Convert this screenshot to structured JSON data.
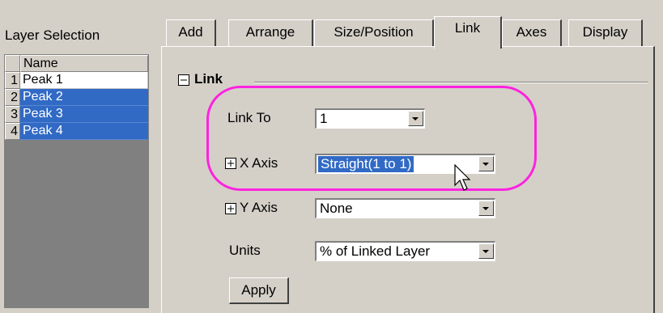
{
  "layer_panel": {
    "title": "Layer Selection",
    "column_header": "Name",
    "rows": [
      {
        "index": "1",
        "name": "Peak 1",
        "selected": false
      },
      {
        "index": "2",
        "name": "Peak 2",
        "selected": true
      },
      {
        "index": "3",
        "name": "Peak 3",
        "selected": true
      },
      {
        "index": "4",
        "name": "Peak 4",
        "selected": true
      }
    ]
  },
  "tabs": [
    {
      "label": "Add",
      "active": false
    },
    {
      "label": "Arrange",
      "active": false
    },
    {
      "label": "Size/Position",
      "active": false
    },
    {
      "label": "Link",
      "active": true
    },
    {
      "label": "Axes",
      "active": false
    },
    {
      "label": "Display",
      "active": false
    }
  ],
  "link_section": {
    "toggle_symbol": "−",
    "title": "Link",
    "link_to": {
      "label": "Link To",
      "value": "1"
    },
    "x_axis": {
      "expander": "+",
      "label": "X Axis",
      "value": "Straight(1 to 1)"
    },
    "y_axis": {
      "expander": "+",
      "label": "Y Axis",
      "value": "None"
    },
    "units": {
      "label": "Units",
      "value": "% of Linked Layer"
    },
    "apply_label": "Apply"
  },
  "colors": {
    "highlight": "#ff22e0",
    "selection": "#316ac5",
    "face": "#d4d0c8"
  }
}
